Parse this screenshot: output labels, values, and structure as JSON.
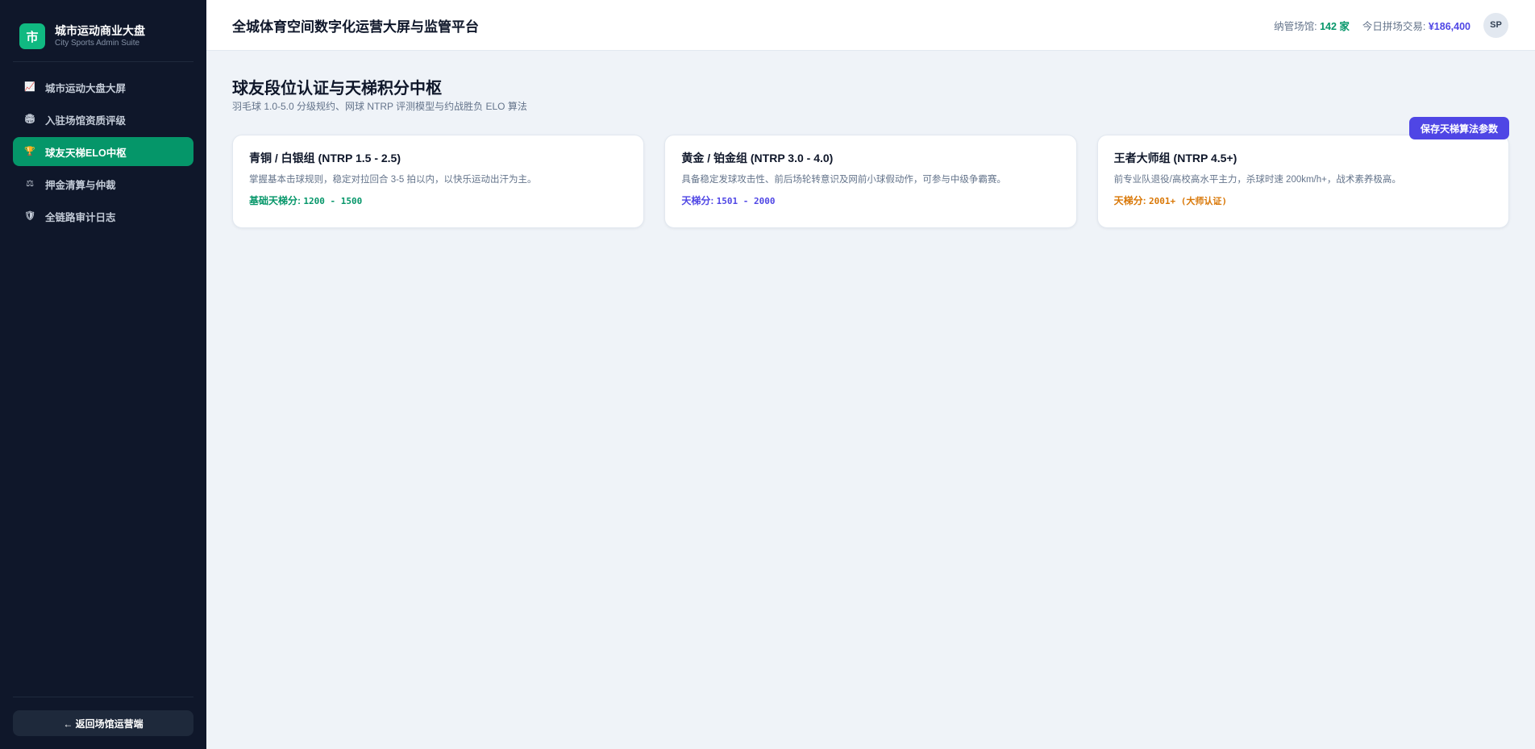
{
  "sidebar": {
    "brand_logo": "市",
    "brand_title": "城市运动商业大盘",
    "brand_subtitle": "City Sports Admin Suite",
    "items": [
      {
        "icon": "📈",
        "label": "城市运动大盘大屏",
        "active": false
      },
      {
        "icon": "🏟",
        "label": "入驻场馆资质评级",
        "active": false
      },
      {
        "icon": "🏆",
        "label": "球友天梯ELO中枢",
        "active": true
      },
      {
        "icon": "⚖",
        "label": "押金清算与仲裁",
        "active": false
      },
      {
        "icon": "🛡",
        "label": "全链路审计日志",
        "active": false
      }
    ],
    "back_label": "← 返回场馆运营端"
  },
  "header": {
    "title": "全城体育空间数字化运营大屏与监管平台",
    "venues_label": "纳管场馆: ",
    "venues_value": "142 家",
    "trade_label": "今日拼场交易: ",
    "trade_value": "¥186,400",
    "avatar": "SP"
  },
  "main": {
    "title": "球友段位认证与天梯积分中枢",
    "subtitle": "羽毛球 1.0-5.0 分级规约、网球 NTRP 评测模型与约战胜负 ELO 算法",
    "save_button": "保存天梯算法参数",
    "cards": [
      {
        "title": "青铜 / 白银组 (NTRP 1.5 - 2.5)",
        "desc": "掌握基本击球规则，稳定对拉回合 3-5 拍以内，以快乐运动出汗为主。",
        "score_label": "基础天梯分: ",
        "score_value": "1200 - 1500",
        "color": "#059669"
      },
      {
        "title": "黄金 / 铂金组 (NTRP 3.0 - 4.0)",
        "desc": "具备稳定发球攻击性、前后场轮转意识及网前小球假动作，可参与中级争霸赛。",
        "score_label": "天梯分: ",
        "score_value": "1501 - 2000",
        "color": "#4f46e5"
      },
      {
        "title": "王者大师组 (NTRP 4.5+)",
        "desc": "前专业队退役/高校高水平主力，杀球时速 200km/h+，战术素养极高。",
        "score_label": "天梯分: ",
        "score_value": "2001+ (大师认证)",
        "color": "#d97706"
      }
    ]
  },
  "colors": {
    "sidebar_bg": "#0f172a",
    "accent_green": "#059669",
    "accent_purple": "#4f46e5",
    "accent_amber": "#d97706"
  }
}
